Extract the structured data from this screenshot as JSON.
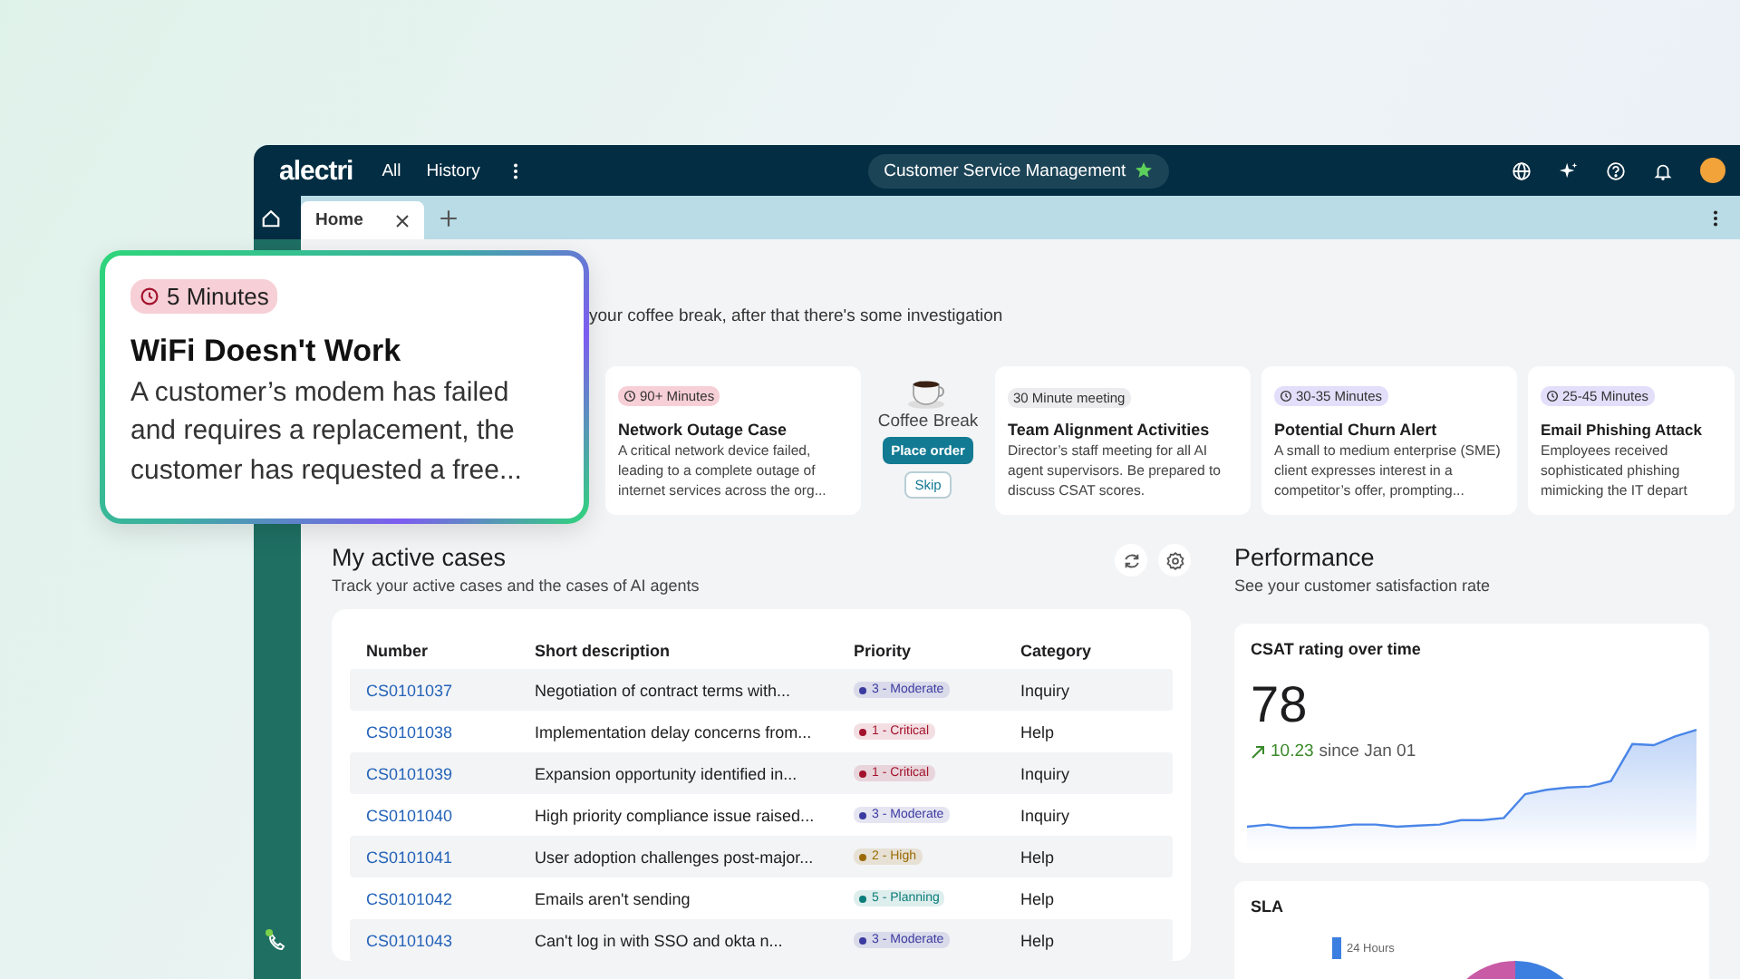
{
  "top_bar": {
    "logo": "alectri",
    "nav": [
      "All",
      "History"
    ],
    "workspace": "Customer Service Management"
  },
  "tabs": [
    {
      "label": "Home",
      "selected": true
    }
  ],
  "intro": {
    "subtitle": "your coffee break, after that there's some investigation"
  },
  "task_cards": [
    {
      "kind": "task",
      "badge": "90+ Minutes",
      "clock": true,
      "color": "#f7cfd6",
      "title": "Network Outage Case",
      "description": "A critical network device failed, leading to a complete outage of internet services across the org..."
    },
    {
      "kind": "break",
      "title": "Coffee Break",
      "primary": "Place order",
      "secondary": "Skip"
    },
    {
      "kind": "task",
      "badge": "30 Minute meeting",
      "clock": false,
      "color": "#ececee",
      "title": "Team Alignment Activities",
      "description": "Director’s staff meeting for all AI agent supervisors. Be prepared to discuss CSAT scores."
    },
    {
      "kind": "task",
      "badge": "30-35 Minutes",
      "clock": true,
      "color": "#e3defa",
      "title": "Potential Churn Alert",
      "description": "A small to medium enterprise (SME) client expresses interest in a competitor’s offer, prompting..."
    },
    {
      "kind": "task",
      "badge": "25-45 Minutes",
      "clock": true,
      "color": "#e3defa",
      "title": "Email Phishing Attack",
      "description": "Employees received sophisticated phishing mimicking the IT depart"
    }
  ],
  "cases": {
    "title": "My active cases",
    "subtitle": "Track your active cases and the cases of AI agents",
    "columns": [
      "Number",
      "Short description",
      "Priority",
      "Category"
    ],
    "rows": [
      {
        "number": "CS0101037",
        "description": "Negotiation of contract terms with...",
        "priority": "3 - Moderate",
        "color": "#3b3aa0",
        "category": "Inquiry"
      },
      {
        "number": "CS0101038",
        "description": "Implementation delay concerns from...",
        "priority": "1 - Critical",
        "color": "#a3122c",
        "category": "Help"
      },
      {
        "number": "CS0101039",
        "description": "Expansion opportunity identified in...",
        "priority": "1 - Critical",
        "color": "#a3122c",
        "category": "Inquiry"
      },
      {
        "number": "CS0101040",
        "description": "High priority compliance issue raised...",
        "priority": "3 - Moderate",
        "color": "#3b3aa0",
        "category": "Inquiry"
      },
      {
        "number": "CS0101041",
        "description": "User adoption challenges post-major...",
        "priority": "2 - High",
        "color": "#9a6a00",
        "category": "Help"
      },
      {
        "number": "CS0101042",
        "description": "Emails aren't sending",
        "priority": "5 - Planning",
        "color": "#0b7d7a",
        "category": "Help"
      },
      {
        "number": "CS0101043",
        "description": "Can't log in with SSO and okta n...",
        "priority": "3 - Moderate",
        "color": "#3b3aa0",
        "category": "Help"
      }
    ]
  },
  "performance": {
    "title": "Performance",
    "subtitle": "See your customer satisfaction rate",
    "csat": {
      "title": "CSAT rating over time",
      "value": "78",
      "change": "10.23",
      "since": "since Jan 01"
    },
    "sla": {
      "title": "SLA",
      "legend": "24 Hours"
    }
  },
  "floating_card": {
    "badge": "5 Minutes",
    "title": "WiFi Doesn't Work",
    "description": "A customer’s modem has failed and requires a replacement, the customer has requested a free..."
  }
}
